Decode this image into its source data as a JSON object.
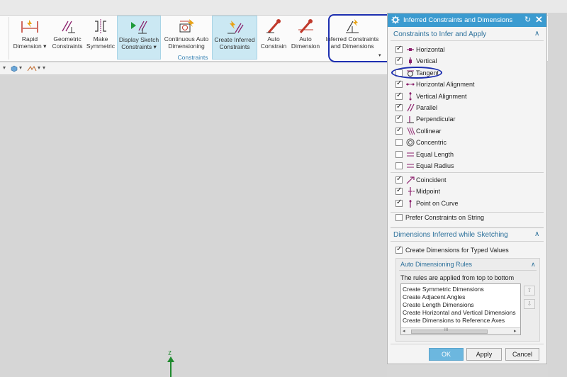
{
  "ribbon": {
    "items": [
      {
        "label": "Rapid Dimension ▾",
        "line1": "Rapid",
        "line2": "Dimension ▾"
      },
      {
        "label": "Geometric Constraints",
        "line1": "Geometric",
        "line2": "Constraints"
      },
      {
        "label": "Make Symmetric",
        "line1": "Make",
        "line2": "Symmetric"
      },
      {
        "label": "Display Sketch Constraints ▾",
        "line1": "Display Sketch",
        "line2": "Constraints ▾"
      },
      {
        "label": "Continuous Auto Dimensioning",
        "line1": "Continuous Auto",
        "line2": "Dimensioning"
      },
      {
        "label": "Create Inferred Constraints",
        "line1": "Create Inferred",
        "line2": "Constraints"
      },
      {
        "label": "Auto Constrain",
        "line1": "Auto",
        "line2": "Constrain"
      },
      {
        "label": "Auto Dimension",
        "line1": "Auto",
        "line2": "Dimension"
      },
      {
        "label": "Inferred Constraints and Dimensions",
        "line1": "Inferred Constraints",
        "line2": "and Dimensions"
      }
    ],
    "group_label": "Constraints",
    "more_glyph": "▾"
  },
  "toolbar2": {
    "glyphs": [
      "▾",
      "▾",
      "▾",
      "▾"
    ]
  },
  "canvas": {
    "axis_label": "Z"
  },
  "dialog": {
    "title": "Inferred Constraints and Dimensions",
    "reset_glyph": "↻",
    "close_glyph": "✕",
    "section1": {
      "heading": "Constraints to Infer and Apply",
      "chevron": "∧",
      "constraints": [
        {
          "label": "Horizontal",
          "checked": true,
          "icon": "horizontal-icon"
        },
        {
          "label": "Vertical",
          "checked": true,
          "icon": "vertical-icon"
        },
        {
          "label": "Tangent",
          "checked": false,
          "icon": "tangent-icon"
        },
        {
          "label": "Horizontal Alignment",
          "checked": true,
          "icon": "horizontal-alignment-icon"
        },
        {
          "label": "Vertical Alignment",
          "checked": true,
          "icon": "vertical-alignment-icon"
        },
        {
          "label": "Parallel",
          "checked": true,
          "icon": "parallel-icon"
        },
        {
          "label": "Perpendicular",
          "checked": true,
          "icon": "perpendicular-icon"
        },
        {
          "label": "Collinear",
          "checked": true,
          "icon": "collinear-icon"
        },
        {
          "label": "Concentric",
          "checked": false,
          "icon": "concentric-icon"
        },
        {
          "label": "Equal Length",
          "checked": false,
          "icon": "equal-length-icon"
        },
        {
          "label": "Equal Radius",
          "checked": false,
          "icon": "equal-radius-icon"
        }
      ],
      "point_constraints": [
        {
          "label": "Coincident",
          "checked": true,
          "icon": "coincident-icon"
        },
        {
          "label": "Midpoint",
          "checked": true,
          "icon": "midpoint-icon"
        },
        {
          "label": "Point on Curve",
          "checked": true,
          "icon": "point-on-curve-icon"
        }
      ],
      "prefer": {
        "label": "Prefer Constraints on String",
        "checked": false
      }
    },
    "section2": {
      "heading": "Dimensions Inferred while Sketching",
      "chevron": "∧",
      "create_dims": {
        "label": "Create Dimensions for Typed Values",
        "checked": true
      },
      "rules": {
        "heading": "Auto Dimensioning Rules",
        "chevron": "∧",
        "description": "The rules are applied from top to bottom",
        "items": [
          "Create Symmetric Dimensions",
          "Create Adjacent Angles",
          "Create Length Dimensions",
          "Create Horizontal and Vertical Dimensions",
          "Create Dimensions to Reference Axes"
        ],
        "scroll_left": "◂",
        "scroll_right": "▸",
        "scroll_grip": "III",
        "move_up": "⇧",
        "move_down": "⇩"
      }
    },
    "buttons": {
      "ok": "OK",
      "apply": "Apply",
      "cancel": "Cancel"
    }
  },
  "colors": {
    "accent": "#3b9bd0",
    "annotation": "#1d2fb0",
    "section_heading": "#2a6f9a",
    "constraint_icon": "#8a1f6b",
    "axis": "#1f8a2e"
  }
}
